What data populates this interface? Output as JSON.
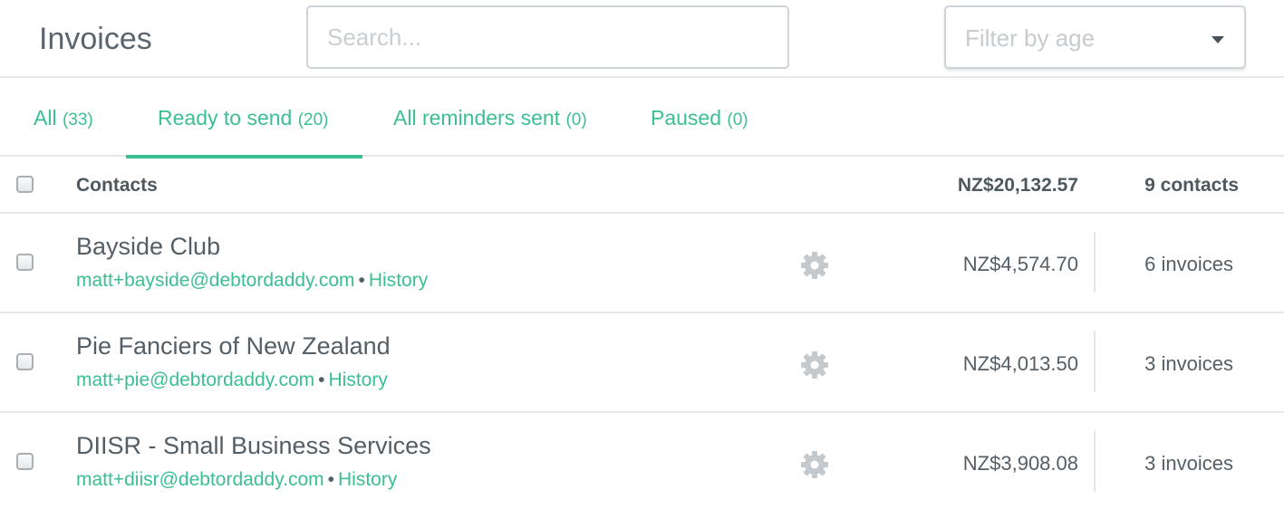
{
  "header": {
    "title": "Invoices",
    "search_placeholder": "Search...",
    "filter_label": "Filter by age"
  },
  "tabs": [
    {
      "label": "All",
      "count": "(33)",
      "active": false
    },
    {
      "label": "Ready to send",
      "count": "(20)",
      "active": true
    },
    {
      "label": "All reminders sent",
      "count": "(0)",
      "active": false
    },
    {
      "label": "Paused",
      "count": "(0)",
      "active": false
    }
  ],
  "table": {
    "header_label": "Contacts",
    "total": "NZ$20,132.57",
    "contacts_count": "9 contacts"
  },
  "rows": [
    {
      "name": "Bayside Club",
      "email": "matt+bayside@debtordaddy.com",
      "history_label": "History",
      "amount": "NZ$4,574.70",
      "invoices": "6 invoices"
    },
    {
      "name": "Pie Fanciers of New Zealand",
      "email": "matt+pie@debtordaddy.com",
      "history_label": "History",
      "amount": "NZ$4,013.50",
      "invoices": "3 invoices"
    },
    {
      "name": "DIISR - Small Business Services",
      "email": "matt+diisr@debtordaddy.com",
      "history_label": "History",
      "amount": "NZ$3,908.08",
      "invoices": "3 invoices"
    }
  ],
  "colors": {
    "accent": "#3bbf91",
    "text": "#545e66",
    "border": "#e6e8ea",
    "gear": "#c4c9cd"
  },
  "icons": {
    "gear": "gear-icon",
    "caret": "chevron-down-icon"
  }
}
